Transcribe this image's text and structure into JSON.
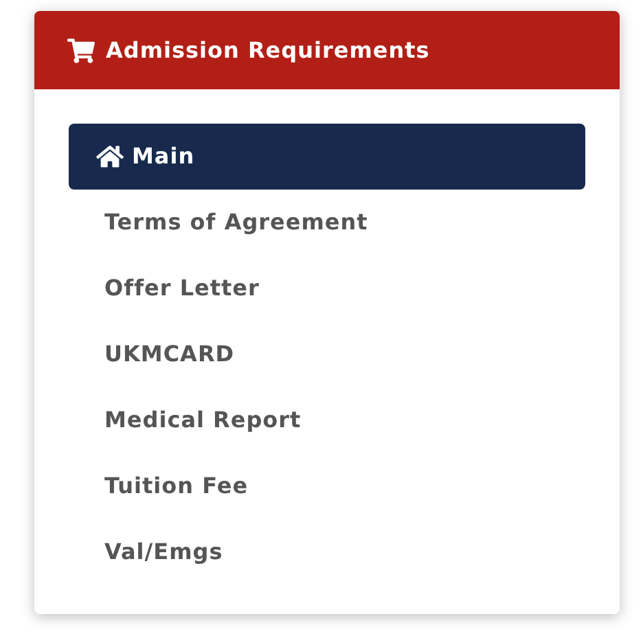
{
  "panel": {
    "title": "Admission Requirements"
  },
  "menu": [
    {
      "label": "Main",
      "selected": true
    },
    {
      "label": "Terms of Agreement",
      "selected": false
    },
    {
      "label": "Offer Letter",
      "selected": false
    },
    {
      "label": "UKMCARD",
      "selected": false
    },
    {
      "label": "Medical Report",
      "selected": false
    },
    {
      "label": "Tuition Fee",
      "selected": false
    },
    {
      "label": "Val/Emgs",
      "selected": false
    }
  ]
}
